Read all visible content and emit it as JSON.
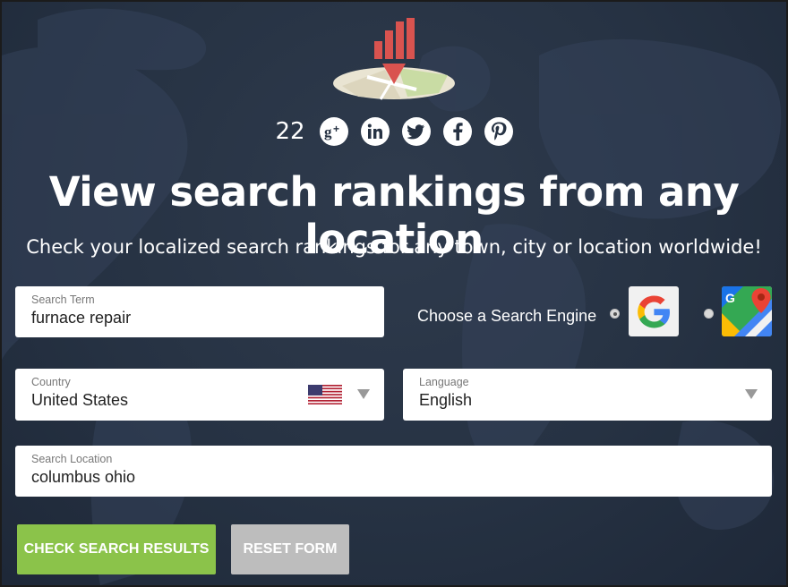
{
  "header": {
    "share_count": "22",
    "social_icons": [
      "google-plus-icon",
      "linkedin-icon",
      "twitter-icon",
      "facebook-icon",
      "pinterest-icon"
    ],
    "title": "View search rankings from any location",
    "subtitle": "Check your localized search rankings for any town, city or location worldwide!"
  },
  "form": {
    "search_term": {
      "label": "Search Term",
      "value": "furnace repair"
    },
    "engine": {
      "label": "Choose a Search Engine",
      "options": [
        {
          "name": "google-icon",
          "selected": true
        },
        {
          "name": "google-maps-icon",
          "selected": false
        }
      ]
    },
    "country": {
      "label": "Country",
      "value": "United States",
      "flag": "us-flag-icon"
    },
    "language": {
      "label": "Language",
      "value": "English"
    },
    "location": {
      "label": "Search Location",
      "value": "columbus ohio"
    }
  },
  "actions": {
    "submit_label": "CHECK SEARCH RESULTS",
    "reset_label": "RESET FORM"
  },
  "colors": {
    "background": "#263243",
    "accent_green": "#8bc34a",
    "reset_gray": "#bdbdbd",
    "logo_red": "#d9534f"
  }
}
